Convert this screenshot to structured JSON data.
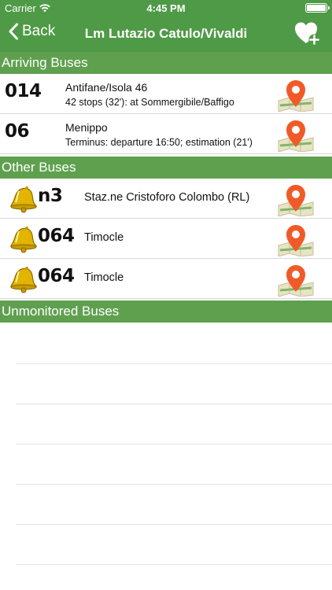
{
  "status_bar": {
    "carrier": "Carrier",
    "time": "4:45 PM"
  },
  "nav": {
    "back_label": "Back",
    "title": "Lm Lutazio Catulo/Vivaldi"
  },
  "sections": {
    "arriving": "Arriving Buses",
    "other": "Other Buses",
    "unmonitored": "Unmonitored Buses"
  },
  "arriving_buses": [
    {
      "code": "014",
      "line1": "Antifane/Isola 46",
      "line2": "42 stops (32'): at Sommergibile/Baffigo"
    },
    {
      "code": "06",
      "line1": "Menippo",
      "line2": "Terminus: departure 16:50; estimation (21')"
    }
  ],
  "other_buses": [
    {
      "code": "n3",
      "destination": "Staz.ne Cristoforo Colombo (RL)"
    },
    {
      "code": "064",
      "destination": "Timocle"
    },
    {
      "code": "064",
      "destination": "Timocle"
    }
  ],
  "colors": {
    "brand_green": "#4f9a46",
    "section_green": "#5fa04f",
    "pin_orange": "#f05a28",
    "bell_gold": "#e3b400"
  },
  "icons": [
    "back-chevron-icon",
    "favorite-add-icon",
    "map-pin-icon",
    "bell-icon",
    "wifi-icon",
    "battery-icon"
  ]
}
